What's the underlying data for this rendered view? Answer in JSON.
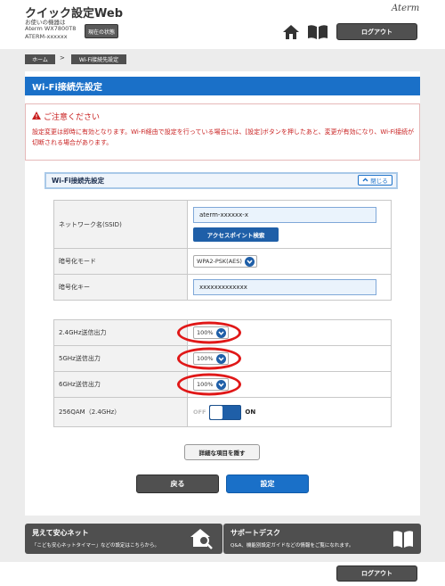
{
  "header": {
    "app_title": "クイック設定Web",
    "device_label": "お使いの機器は",
    "device_model": "Aterm WX7800T8",
    "device_ssid": "ATERM-xxxxxx",
    "status_button": "現在の状態",
    "brand": "Aterm",
    "logout_label": "ログアウト"
  },
  "breadcrumb": {
    "home": "ホーム",
    "separator": ">",
    "current": "Wi-Fi接続先設定"
  },
  "page_title": "Wi-Fi接続先設定",
  "caution": {
    "title": "ご注意ください",
    "body": "設定変更は即時に有効となります。Wi-Fi経由で設定を行っている場合には、[設定]ボタンを押したあと、変更が有効になり、Wi-Fi接続が切断される場合があります。"
  },
  "section": {
    "title": "Wi-Fi接続先設定",
    "close_label": "閉じる"
  },
  "form": {
    "ssid_label": "ネットワーク名(SSID)",
    "ssid_value": "aterm-xxxxxx-x",
    "ap_search_button": "アクセスポイント検索",
    "encryption_label": "暗号化モード",
    "encryption_value": "WPA2-PSK(AES)",
    "key_label": "暗号化キー",
    "key_value": "xxxxxxxxxxxxx",
    "tx24_label": "2.4GHz送信出力",
    "tx24_value": "100%",
    "tx5_label": "5GHz送信出力",
    "tx5_value": "100%",
    "tx6_label": "6GHz送信出力",
    "tx6_value": "100%",
    "qam_label": "256QAM（2.4GHz）",
    "qam_off": "OFF",
    "qam_on": "ON"
  },
  "buttons": {
    "hide_details": "詳細な項目を隠す",
    "back": "戻る",
    "apply": "設定"
  },
  "banners": [
    {
      "title": "見えて安心ネット",
      "subtitle": "「こども安心ネットタイマー」などの設定はこちらから。"
    },
    {
      "title": "サポートデスク",
      "subtitle": "Q&A、機能別設定ガイドなどの情報をご覧になれます。"
    }
  ],
  "footer": {
    "logout_label": "ログアウト"
  },
  "colors": {
    "accent_blue": "#1a70c8",
    "caution_red": "#c81e1e",
    "highlight_ring": "#e01818",
    "dark_button": "#505050"
  }
}
